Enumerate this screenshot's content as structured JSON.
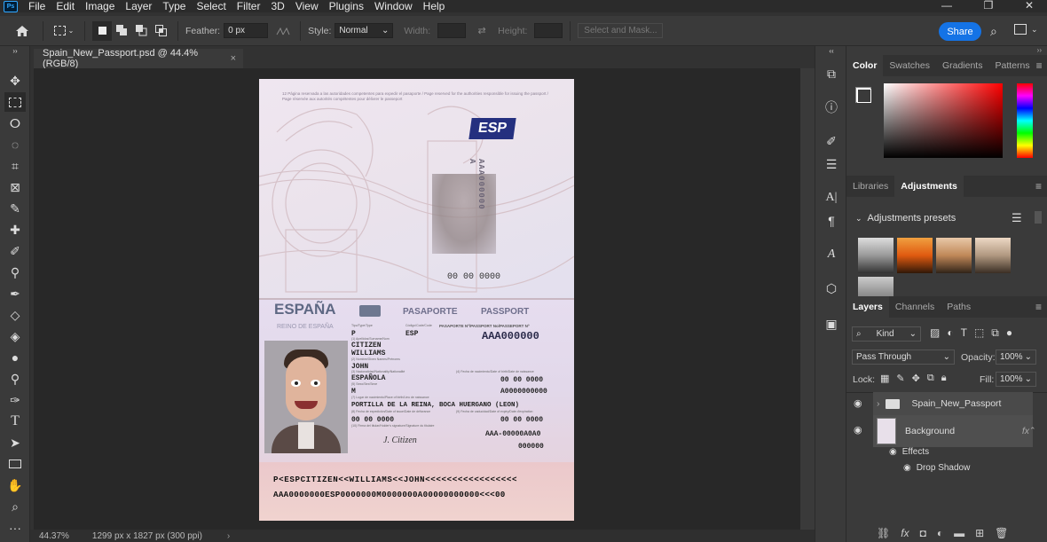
{
  "menubar": {
    "logo": "Ps",
    "items": [
      "File",
      "Edit",
      "Image",
      "Layer",
      "Type",
      "Select",
      "Filter",
      "3D",
      "View",
      "Plugins",
      "Window",
      "Help"
    ]
  },
  "options": {
    "feather_label": "Feather:",
    "feather_value": "0 px",
    "style_label": "Style:",
    "style_value": "Normal",
    "width_label": "Width:",
    "height_label": "Height:",
    "select_mask": "Select and Mask...",
    "share": "Share"
  },
  "document": {
    "tab_title": "Spain_New_Passport.psd @ 44.4% (RGB/8)",
    "zoom": "44.37%",
    "dimensions": "1299 px x 1827 px (300 ppi)"
  },
  "passport": {
    "top_text": "12  Página reservada a las autoridades competentes para expedir el pasaporte / Page reserved for the authorities responsible for issuing the passport / Page réservée aux autorités compétentes pour délivrer le passeport",
    "esp": "ESP",
    "vertical_number": "AAA000000 A",
    "small_code": "00 00 0000",
    "country": "ESPAÑA",
    "pasaporte": "PASAPORTE",
    "passport": "PASSPORT",
    "reino": "REINO DE ESPAÑA",
    "type_label": "Tipo/Type/Type",
    "code_label": "Código/Code/Code",
    "number_label": "PASAPORTE Nº/PASSPORT No/PASSEPORT Nº",
    "type": "P",
    "code": "ESP",
    "number": "AAA000000",
    "surname1": "CITIZEN",
    "surname2": "WILLIAMS",
    "given": "JOHN",
    "nationality": "ESPAÑOLA",
    "dob": "00 00 0000",
    "sex": "M",
    "personal_no": "A0000000000",
    "birthplace": "PORTILLA DE LA REINA, BOCA HUERGANO (LEON)",
    "issue": "00 00 0000",
    "expiry": "00 00 0000",
    "authority": "AAA-00000A0A0",
    "extra": "000000",
    "signature": "J. Citizen",
    "mrz1": "P<ESPCITIZEN<<WILLIAMS<<JOHN<<<<<<<<<<<<<<<<<",
    "mrz2": "AAA0000000ESP0000000M0000000A00000000000<<<00"
  },
  "color_panel": {
    "tabs": [
      "Color",
      "Swatches",
      "Gradients",
      "Patterns"
    ]
  },
  "adjust_panel": {
    "tabs": [
      "Libraries",
      "Adjustments"
    ],
    "title": "Adjustments presets"
  },
  "layers_panel": {
    "tabs": [
      "Layers",
      "Channels",
      "Paths"
    ],
    "kind": "Kind",
    "blend": "Pass Through",
    "opacity_label": "Opacity:",
    "opacity": "100%",
    "lock_label": "Lock:",
    "fill_label": "Fill:",
    "fill": "100%",
    "layers": [
      "Spain_New_Passport",
      "Background"
    ],
    "effects": "Effects",
    "drop_shadow": "Drop Shadow",
    "fx": "fx"
  }
}
